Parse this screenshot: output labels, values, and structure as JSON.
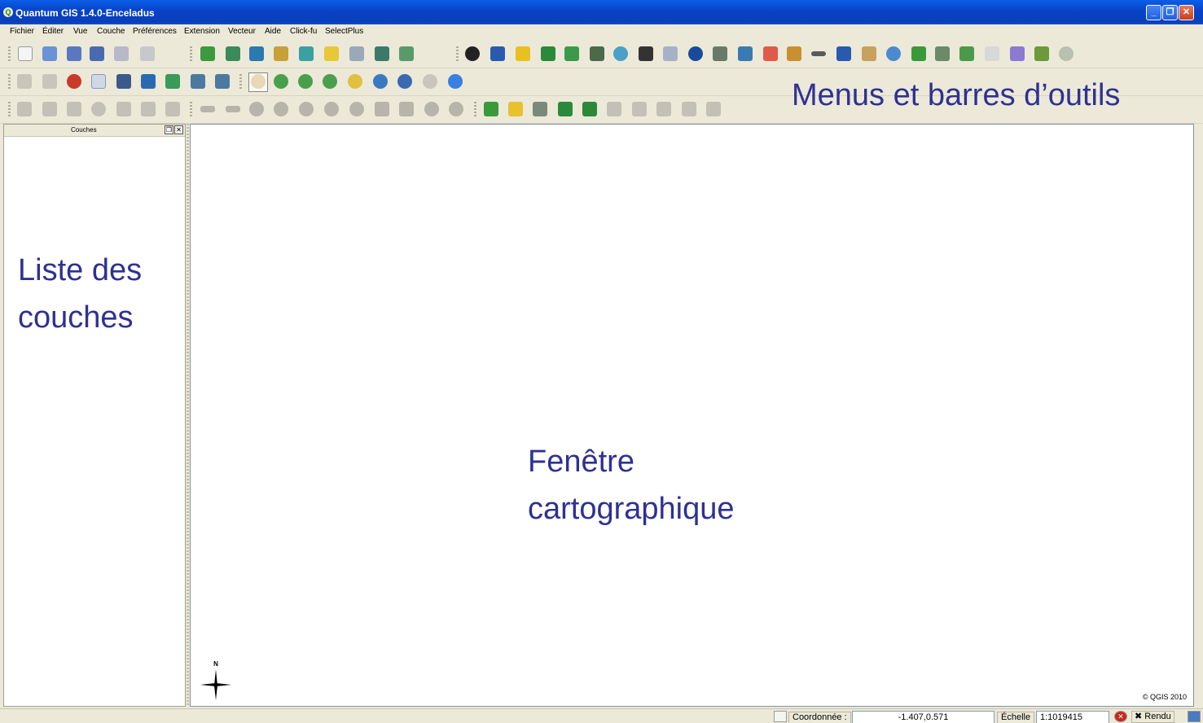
{
  "window": {
    "title": "Quantum GIS 1.4.0-Enceladus",
    "app_icon_glyph": "Q"
  },
  "window_controls": {
    "minimize": "_",
    "maximize": "❐",
    "close": "✕"
  },
  "menu": {
    "items": [
      "Fichier",
      "Éditer",
      "Vue",
      "Couche",
      "Préférences",
      "Extension",
      "Vecteur",
      "Aide",
      "Click-fu",
      "SelectPlus"
    ]
  },
  "toolbars": {
    "file_icons": [
      "new-project-icon",
      "open-project-icon",
      "save-project-icon",
      "save-as-icon",
      "print-composer-icon",
      "print-icon"
    ],
    "layer_icons": [
      "add-vector-layer-icon",
      "add-raster-layer-icon",
      "add-postgis-layer-icon",
      "add-spatialite-layer-icon",
      "add-wms-layer-icon",
      "new-vector-layer-icon",
      "remove-layer-icon",
      "add-wfs-layer-icon",
      "gps-tool-icon"
    ],
    "plugin_icons": [
      "copyright-icon",
      "north-arrow-icon",
      "scale-bar-icon",
      "georeferencer-icon",
      "grass-icon",
      "raster-calc-icon",
      "globe-icon",
      "histogram-icon",
      "label-icon",
      "compass-icon",
      "interpolation-icon",
      "oracle-icon",
      "pdf-icon",
      "edit-tool-icon",
      "measure-icon",
      "wms-icon",
      "photo-icon",
      "navigation-icon",
      "refresh-icon",
      "tools-icon",
      "sql-icon",
      "pgis-icon",
      "notepad-icon",
      "mosaic-icon",
      "zoom-search-icon"
    ],
    "identify_icons": [
      "identify-icon",
      "select-icon",
      "deselect-icon",
      "attribute-table-icon",
      "measure-line-icon",
      "measure-area-icon",
      "annotation-icon",
      "home-icon",
      "home-zoom-icon"
    ],
    "navigation_icons": [
      "pan-icon",
      "zoom-in-icon",
      "zoom-out-icon",
      "zoom-full-icon",
      "zoom-layer-icon",
      "zoom-selection-icon",
      "zoom-last-icon",
      "zoom-next-icon",
      "refresh-map-icon"
    ],
    "edit_icons": [
      "toggle-edit-icon",
      "move-feature-icon",
      "node-tool-icon",
      "delete-selected-icon",
      "cut-icon",
      "copy-icon",
      "paste-icon",
      "undo-icon",
      "redo-icon",
      "add-ring-icon",
      "add-island-icon",
      "simplify-icon",
      "delete-ring-icon",
      "delete-part-icon",
      "reshape-icon",
      "split-icon",
      "merge-icon",
      "rotate-icon"
    ],
    "raster_icons": [
      "raster-terrain-icon",
      "raster-new-icon",
      "raster-edit-icon",
      "raster-stretch-icon",
      "raster-histogram-icon",
      "raster-gray-icon",
      "raster-contrast-icon",
      "raster-pyramid-icon",
      "raster-info-icon",
      "raster-export-icon"
    ]
  },
  "labels": {
    "toolbar_annotation": "Menus et barres d’outils",
    "layers_annotation": [
      "Liste des",
      "couches"
    ],
    "map_annotation": [
      "Fenêtre",
      "cartographique"
    ]
  },
  "layers_panel": {
    "title": "Couches",
    "float_button": "❐",
    "close_button": "✕"
  },
  "map": {
    "north_label": "N",
    "copyright": "© QGIS 2010"
  },
  "statusbar": {
    "coord_label": "Coordonnée :",
    "coord_value": "-1.407,0.571",
    "scale_label": "Échelle",
    "scale_value": "1:1019415",
    "render_label": "Rendu",
    "stop_icon_glyph": "✕",
    "render_check_glyph": "✖"
  },
  "colors": {
    "title_bar": "#0a4fd6",
    "annotation_text": "#2e3192",
    "chrome": "#ece9d8"
  }
}
